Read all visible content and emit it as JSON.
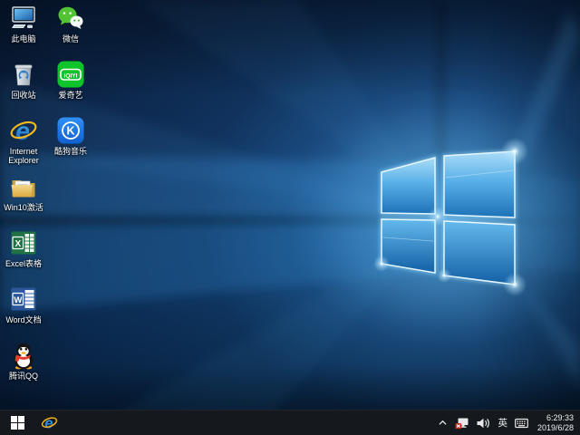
{
  "desktop": {
    "icons": [
      {
        "label": "此电脑"
      },
      {
        "label": "微信"
      },
      {
        "label": "回收站"
      },
      {
        "label": "爱奇艺"
      },
      {
        "label": "Internet Explorer"
      },
      {
        "label": "酷狗音乐"
      },
      {
        "label": "Win10激活"
      },
      {
        "label": "Excel表格"
      },
      {
        "label": "Word文档"
      },
      {
        "label": "腾讯QQ"
      }
    ],
    "logo_glyphs": {
      "iqiyi": "iQIYI",
      "kugou": "K",
      "excel": "X",
      "word": "W",
      "ie": "e"
    }
  },
  "taskbar": {
    "tray": {
      "ime": "英",
      "time": "6:29:33",
      "date": "2019/6/28"
    }
  },
  "colors": {
    "wallpaper_dark": "#0a1f3d",
    "wallpaper_mid": "#0d2950",
    "logo_pane_blue": "#58b0e8",
    "taskbar_bg": "#15181d",
    "wechat_green": "#52c332",
    "iqiyi_green": "#0fc32b",
    "kugou_blue": "#1f7de0",
    "excel_green": "#1f7244",
    "word_blue": "#2b579a",
    "qq_scarf_red": "#e23b2c",
    "folder_yellow": "#dca93f",
    "ie_blue": "#1f86d6",
    "ie_ring_gold": "#f3b81f",
    "network_error_red": "#c4281c"
  }
}
